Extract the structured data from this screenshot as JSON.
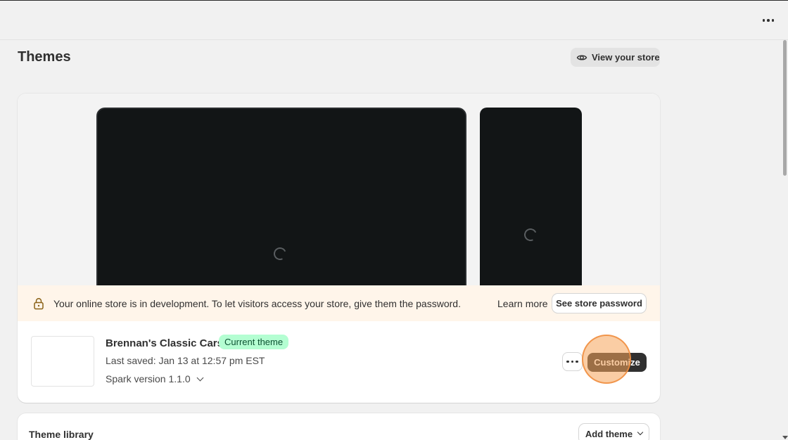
{
  "header": {
    "more_icon": "horizontal-dots-icon"
  },
  "page": {
    "title": "Themes",
    "view_store_label": "View your store",
    "view_store_icon": "eye-icon"
  },
  "preview": {
    "desktop_state": "loading",
    "mobile_state": "loading"
  },
  "banner": {
    "icon": "lock-icon",
    "message": "Your online store is in development. To let visitors access your store, give them the password.",
    "learn_more": "Learn more",
    "button_label": "See store password"
  },
  "current_theme": {
    "name": "Brennan's Classic Cars",
    "badge": "Current theme",
    "last_saved": "Last saved: Jan 13 at 12:57 pm EST",
    "version": "Spark version 1.1.0",
    "more_icon": "horizontal-dots-icon",
    "customize_label": "Customize"
  },
  "library": {
    "title": "Theme library",
    "add_theme_label": "Add theme"
  },
  "colors": {
    "background": "#f1f1f1",
    "badge_bg": "#b4fed2",
    "banner_bg": "#fff5ea",
    "primary_button": "#303030",
    "click_highlight": "#f6a45a"
  }
}
